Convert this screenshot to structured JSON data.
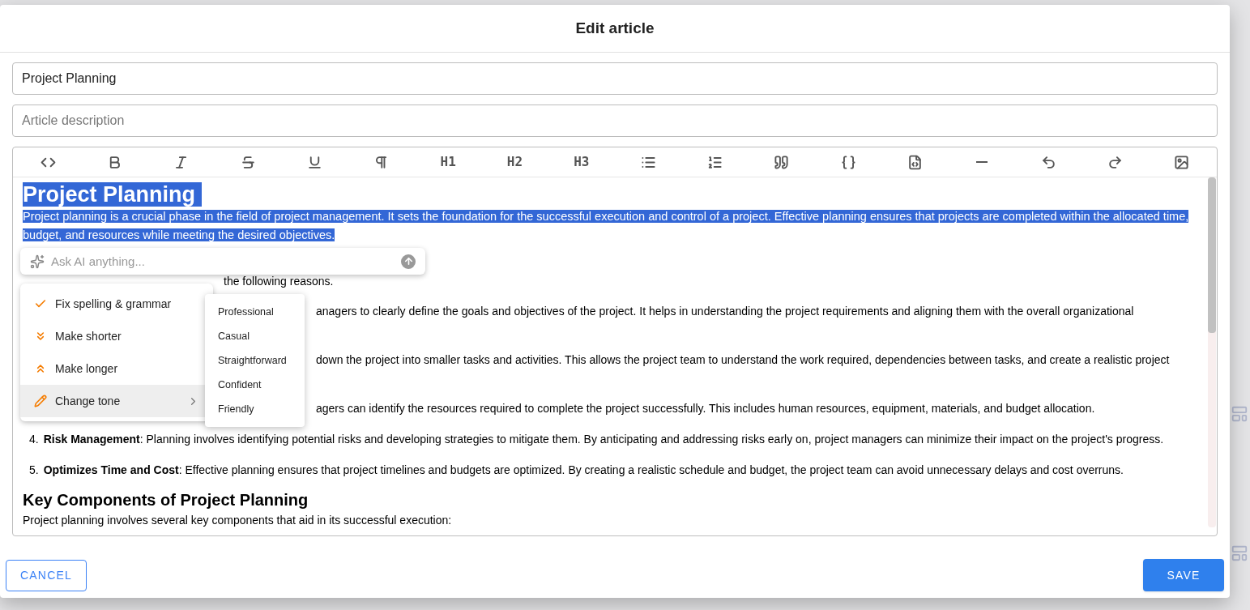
{
  "dialog": {
    "title": "Edit article"
  },
  "title_field": {
    "value": "Project Planning"
  },
  "description_field": {
    "placeholder": "Article description"
  },
  "toolbar": [
    {
      "kind": "code"
    },
    {
      "kind": "bold"
    },
    {
      "kind": "italic"
    },
    {
      "kind": "strike"
    },
    {
      "kind": "underline"
    },
    {
      "kind": "paragraph"
    },
    {
      "kind": "heading",
      "label": "H1"
    },
    {
      "kind": "heading",
      "label": "H2"
    },
    {
      "kind": "heading",
      "label": "H3"
    },
    {
      "kind": "bullets"
    },
    {
      "kind": "numbers"
    },
    {
      "kind": "quote"
    },
    {
      "kind": "braces"
    },
    {
      "kind": "codeblock"
    },
    {
      "kind": "rule"
    },
    {
      "kind": "undo"
    },
    {
      "kind": "redo"
    },
    {
      "kind": "image"
    }
  ],
  "content": {
    "selected": true,
    "heading": "Project Planning",
    "paragraph": "Project planning is a crucial phase in the field of project management. It sets the foundation for the successful execution and control of a project. Effective planning ensures that projects are completed within the allocated time, budget, and resources while meeting the desired objectives.",
    "intro_visible": "the following reasons.",
    "covered_items": [
      {
        "visible_text": "anagers to clearly define the goals and objectives of the project. It helps in understanding the project requirements and aligning them with the overall organizational"
      },
      {
        "visible_text": "down the project into smaller tasks and activities. This allows the project team to understand the work required, dependencies between tasks, and create a realistic project"
      },
      {
        "visible_text": "agers can identify the resources required to complete the project successfully. This includes human resources, equipment, materials, and budget allocation."
      }
    ],
    "items": [
      {
        "number": "4.",
        "term": "Risk Management",
        "text": ": Planning involves identifying potential risks and developing strategies to mitigate them. By anticipating and addressing risks early on, project managers can minimize their impact on the project's progress."
      },
      {
        "number": "5.",
        "term": "Optimizes Time and Cost",
        "text": ": Effective planning ensures that project timelines and budgets are optimized. By creating a realistic schedule and budget, the project team can avoid unnecessary delays and cost overruns."
      }
    ],
    "heading_2": "Key Components of Project Planning",
    "paragraph_2": "Project planning involves several key components that aid in its successful execution:"
  },
  "ai_prompt": {
    "placeholder": "Ask AI anything..."
  },
  "ai_menu": [
    {
      "kind": "check",
      "label": "Fix spelling & grammar",
      "selected": false
    },
    {
      "kind": "shorter",
      "label": "Make shorter",
      "selected": false
    },
    {
      "kind": "longer",
      "label": "Make longer",
      "selected": false
    },
    {
      "kind": "tone",
      "label": "Change tone",
      "selected": true,
      "submenu": true
    }
  ],
  "tone_menu": [
    "Professional",
    "Casual",
    "Straightforward",
    "Confident",
    "Friendly"
  ],
  "buttons": {
    "cancel": "CANCEL",
    "save": "SAVE"
  }
}
